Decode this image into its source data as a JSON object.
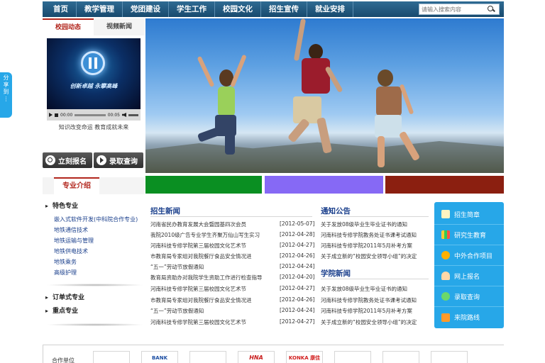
{
  "share": {
    "label_chars": [
      "分",
      "享",
      "到",
      "⋮"
    ]
  },
  "nav": {
    "items": [
      "首页",
      "教学管理",
      "党团建设",
      "学生工作",
      "校园文化",
      "招生宣传",
      "就业安排"
    ],
    "search_placeholder": "请输入搜索内容"
  },
  "news_tabs": [
    "校园动态",
    "视频新闻"
  ],
  "video": {
    "caption": "创新卓越  永攀高峰",
    "time_current": "00:00",
    "time_total": "00:05"
  },
  "motto": "知识改变命运  教育成就未来",
  "actions": {
    "register": "立刻报名",
    "query": "录取查询"
  },
  "specialties": {
    "title": "专业介绍",
    "group_feature": "特色专业",
    "items": [
      "嵌入式软件开发(中科院合作专业)",
      "地铁通信技术",
      "地铁运输与管理",
      "地铁供电技术",
      "地铁乘务",
      "高级护理"
    ],
    "group_order": "订单式专业",
    "group_key": "重点专业"
  },
  "colors": {
    "bar_green": "#0a8f22",
    "bar_purple": "#8669f5",
    "bar_red": "#8b1f10",
    "quick_bg": "#27a7e8",
    "nav_bg": "#215478",
    "accent_red": "#b2261d",
    "title_blue": "#1a3f8c"
  },
  "admission_news": {
    "title": "招生新闻",
    "rows": [
      {
        "text": "河南省民办教育发展大会暨园基四次会员",
        "date": "[2012-05-07]"
      },
      {
        "text": "我院2010级广告专业学生齐聚万仙山写生实习",
        "date": "[2012-04-28]"
      },
      {
        "text": "河南科技专修学院第三届校园文化艺术节",
        "date": "[2012-04-27]"
      },
      {
        "text": "市教育局专家组对我院餐厅食品安全情况进",
        "date": "[2012-04-26]"
      },
      {
        "text": "“五一”劳动节放假通知",
        "date": "[2012-04-24]"
      },
      {
        "text": "教育局资助办对我院学生资助工作进行检查指导",
        "date": "[2012-04-20]"
      },
      {
        "text": "河南科技专修学院第三届校园文化艺术节",
        "date": "[2012-04-27]"
      },
      {
        "text": "市教育局专家组对我院餐厅食品安全情况进",
        "date": "[2012-04-26]"
      },
      {
        "text": "“五一”劳动节放假通知",
        "date": "[2012-04-24]"
      },
      {
        "text": "河南科技专修学院第三届校园文化艺术节",
        "date": "[2012-04-27]"
      }
    ]
  },
  "notices": {
    "title": "通知公告",
    "rows": [
      "关于发放08级毕业生毕业证书的通知",
      "河南科技专修学院教务处证书课考试通知",
      "河南科技专修学院2011年5月补考方案",
      "关于成立新的“校园安全领导小组”的决定"
    ]
  },
  "college_news": {
    "title": "学院新闻",
    "rows": [
      "关于发放08级毕业生毕业证书的通知",
      "河南科技专修学院教务处证书课考试通知",
      "河南科技专修学院2011年5月补考方案",
      "关于成立新的“校园安全领导小组”的决定"
    ]
  },
  "quick_links": [
    "招生简章",
    "研究生教育",
    "中外合作项目",
    "网上报名",
    "录取查询",
    "来院路线"
  ],
  "partners": {
    "label": "合作单位",
    "logos": [
      "",
      "BANK",
      "",
      "HNA",
      "KONKA 康佳",
      "",
      "",
      ""
    ]
  }
}
